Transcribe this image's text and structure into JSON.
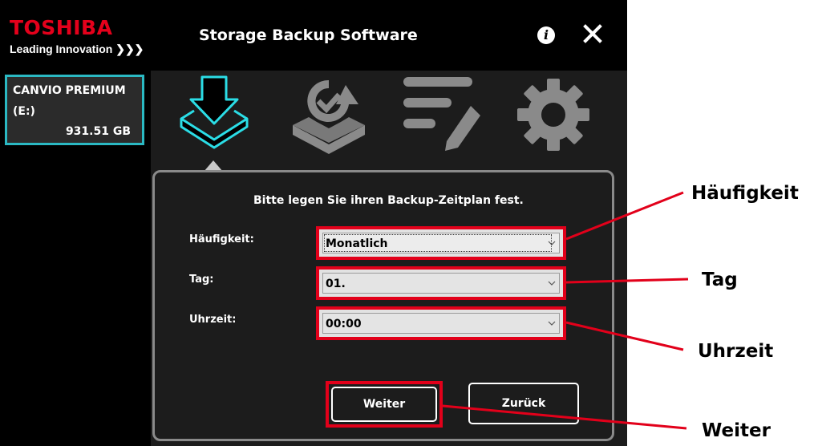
{
  "header": {
    "logo_text": "TOSHIBA",
    "logo_tagline": "Leading Innovation ❯❯❯",
    "title": "Storage Backup Software",
    "info_icon": "i"
  },
  "sidebar": {
    "drive": {
      "name": "CANVIO PREMIUM",
      "letter": "(E:)",
      "size": "931.51 GB"
    }
  },
  "nav": {
    "tabs": [
      {
        "icon": "backup-icon",
        "active": true
      },
      {
        "icon": "restore-icon",
        "active": false
      },
      {
        "icon": "edit-settings-icon",
        "active": false
      },
      {
        "icon": "gear-icon",
        "active": false
      }
    ]
  },
  "panel": {
    "instruction": "Bitte legen Sie ihren Backup-Zeitplan fest.",
    "frequency": {
      "label": "Häufigkeit:",
      "value": "Monatlich"
    },
    "day": {
      "label": "Tag:",
      "value": "01."
    },
    "time": {
      "label": "Uhrzeit:",
      "value": "00:00"
    },
    "next_label": "Weiter",
    "back_label": "Zurück"
  },
  "callouts": {
    "frequency": "Häufigkeit",
    "day": "Tag",
    "time": "Uhrzeit",
    "next": "Weiter"
  },
  "colors": {
    "brand_red": "#e4001b",
    "accent_cyan": "#2bb9c3",
    "highlight_red": "#e2001a",
    "background": "#1c1c1c",
    "icon_inactive": "#888888"
  }
}
